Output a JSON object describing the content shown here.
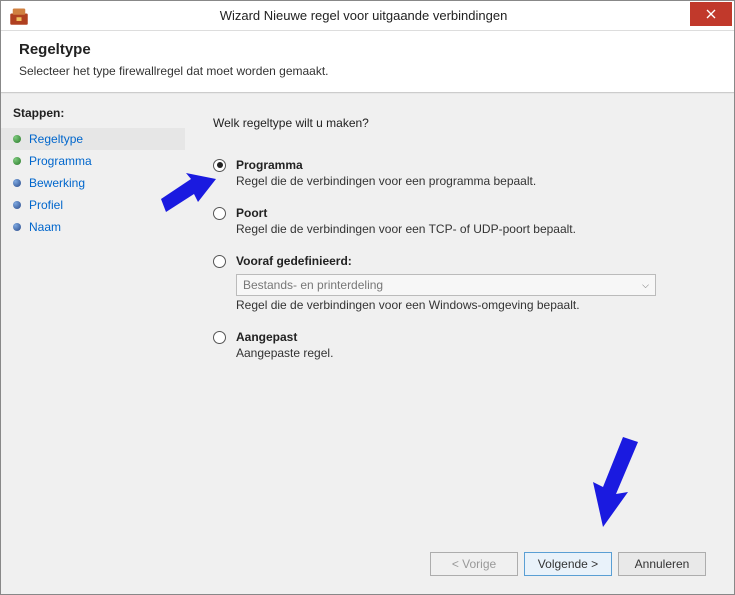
{
  "window": {
    "title": "Wizard Nieuwe regel voor uitgaande verbindingen",
    "close_aria": "Sluiten"
  },
  "header": {
    "title": "Regeltype",
    "subtitle": "Selecteer het type firewallregel dat moet worden gemaakt."
  },
  "sidebar": {
    "heading": "Stappen:",
    "items": [
      {
        "label": "Regeltype",
        "active": true
      },
      {
        "label": "Programma"
      },
      {
        "label": "Bewerking"
      },
      {
        "label": "Profiel"
      },
      {
        "label": "Naam"
      }
    ]
  },
  "main": {
    "question": "Welk regeltype wilt u maken?",
    "options": {
      "programma": {
        "label": "Programma",
        "desc": "Regel die de verbindingen voor een programma bepaalt."
      },
      "poort": {
        "label": "Poort",
        "desc": "Regel die de verbindingen voor een TCP- of UDP-poort bepaalt."
      },
      "vooraf": {
        "label": "Vooraf gedefinieerd:",
        "dropdown": "Bestands- en printerdeling",
        "desc": "Regel die de verbindingen voor een Windows-omgeving bepaalt."
      },
      "aangepast": {
        "label": "Aangepast",
        "desc": "Aangepaste regel."
      }
    },
    "selected": "programma"
  },
  "footer": {
    "back": "< Vorige",
    "next": "Volgende >",
    "cancel": "Annuleren"
  }
}
